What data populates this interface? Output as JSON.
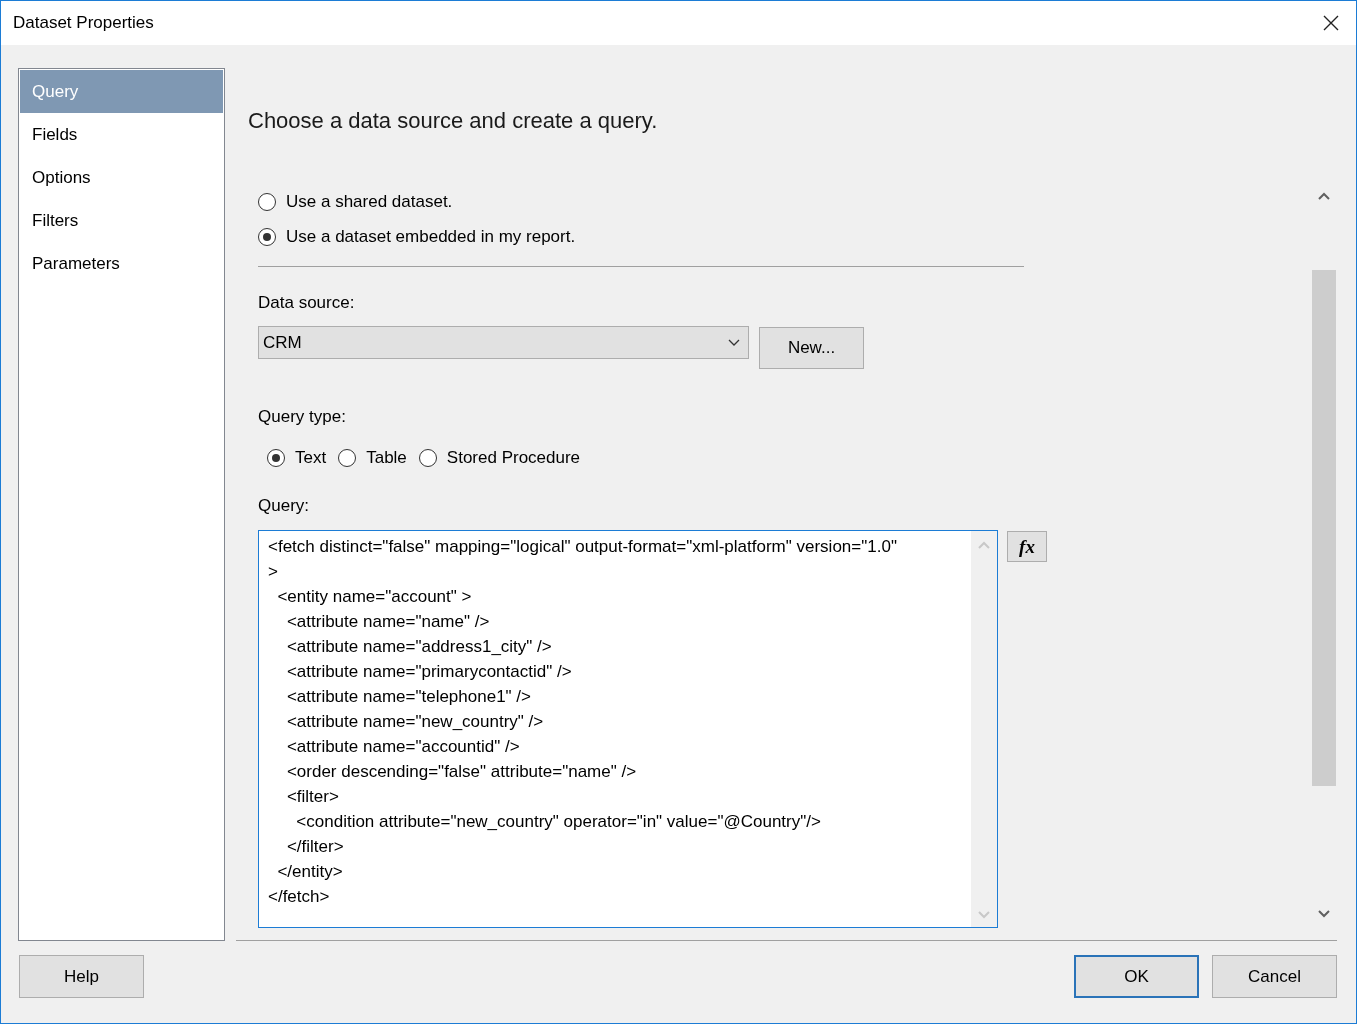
{
  "window": {
    "title": "Dataset Properties"
  },
  "sidebar": {
    "items": [
      {
        "label": "Query",
        "selected": true
      },
      {
        "label": "Fields",
        "selected": false
      },
      {
        "label": "Options",
        "selected": false
      },
      {
        "label": "Filters",
        "selected": false
      },
      {
        "label": "Parameters",
        "selected": false
      }
    ]
  },
  "heading": "Choose a data source and create a query.",
  "dataset_options": [
    {
      "label": "Use a shared dataset.",
      "selected": false
    },
    {
      "label": "Use a dataset embedded in my report.",
      "selected": true
    }
  ],
  "data_source": {
    "label": "Data source:",
    "value": "CRM",
    "new_button": "New..."
  },
  "query_type": {
    "label": "Query type:",
    "options": [
      {
        "label": "Text",
        "selected": true
      },
      {
        "label": "Table",
        "selected": false
      },
      {
        "label": "Stored Procedure",
        "selected": false
      }
    ]
  },
  "query": {
    "label": "Query:",
    "expression_button": "fx",
    "lines": [
      "<fetch distinct=\"false\" mapping=\"logical\" output-format=\"xml-platform\" version=\"1.0\"",
      ">",
      "  <entity name=\"account\" >",
      "    <attribute name=\"name\" />",
      "    <attribute name=\"address1_city\" />",
      "    <attribute name=\"primarycontactid\" />",
      "    <attribute name=\"telephone1\" />",
      "    <attribute name=\"new_country\" />",
      "    <attribute name=\"accountid\" />",
      "    <order descending=\"false\" attribute=\"name\" />",
      "    <filter>",
      "      <condition attribute=\"new_country\" operator=\"in\" value=\"@Country\"/>",
      "    </filter>",
      "  </entity>",
      "</fetch>"
    ]
  },
  "buttons": [
    {
      "label": "Help",
      "default": false
    },
    {
      "label": "OK",
      "default": true
    },
    {
      "label": "Cancel",
      "default": false
    }
  ]
}
